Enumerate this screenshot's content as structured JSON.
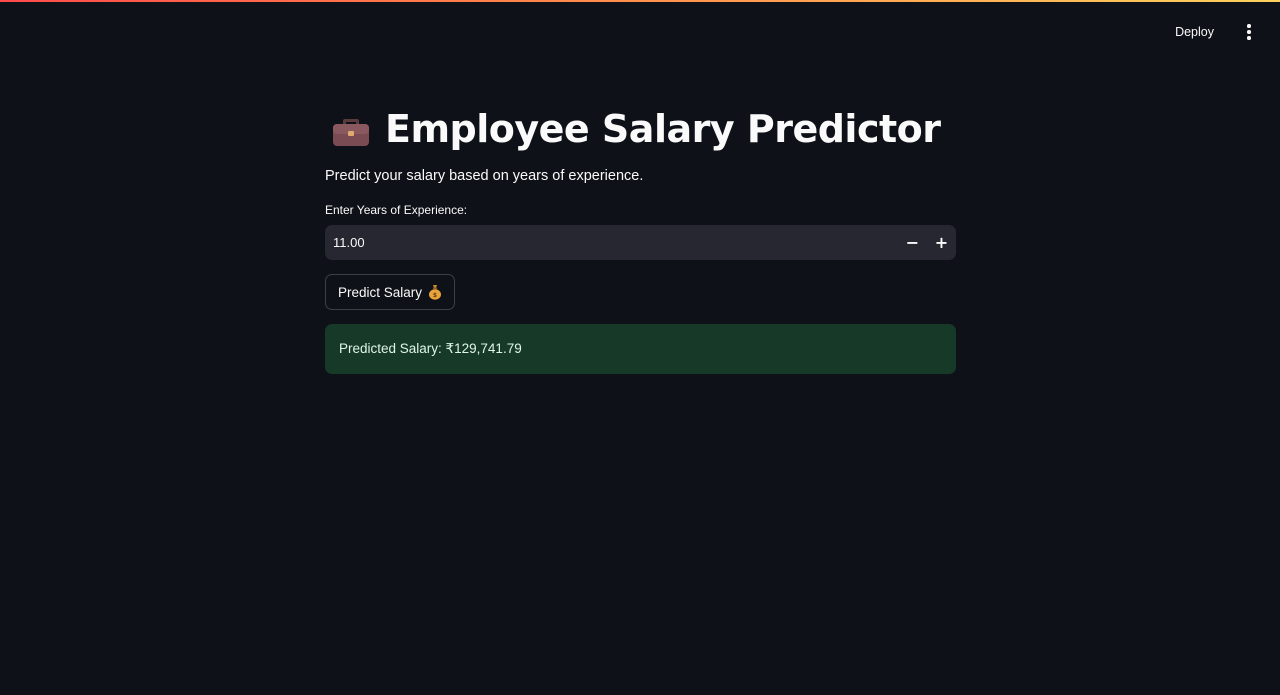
{
  "header": {
    "deploy_label": "Deploy",
    "menu_icon": "more-vertical-icon"
  },
  "main": {
    "title_icon": "briefcase-icon",
    "title": "Employee Salary Predictor",
    "subtitle": "Predict your salary based on years of experience.",
    "experience_input": {
      "label": "Enter Years of Experience:",
      "value": "11.00",
      "decrement_label": "−",
      "increment_label": "+"
    },
    "predict_button": {
      "label": "Predict Salary",
      "icon": "money-bag-icon"
    },
    "result": {
      "text": "Predicted Salary: ₹129,741.79"
    }
  },
  "colors": {
    "background": "#0e1117",
    "input_background": "#262730",
    "success_background": "#173928",
    "top_gradient_start": "#ff4b4b",
    "top_gradient_end": "#ffd15c"
  }
}
